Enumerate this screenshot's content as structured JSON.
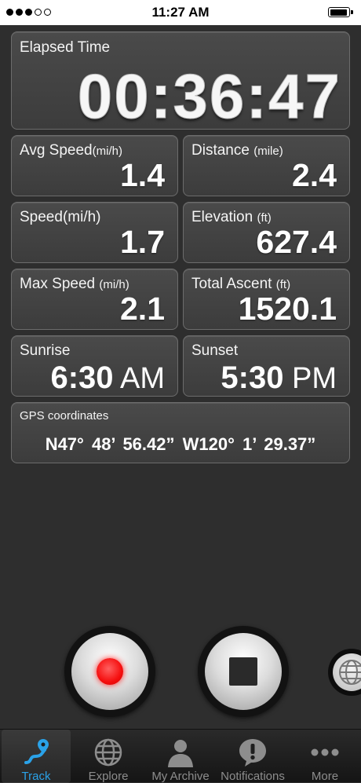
{
  "status_bar": {
    "time": "11:27 AM",
    "signal_bars_filled": 3,
    "signal_bars_total": 5
  },
  "elapsed": {
    "label": "Elapsed Time",
    "value": "00:36:47"
  },
  "stats": {
    "avg_speed": {
      "label": "Avg Speed",
      "unit": "(mi/h)",
      "value": "1.4"
    },
    "distance": {
      "label": "Distance",
      "unit": "(mile)",
      "value": "2.4"
    },
    "speed": {
      "label": "Speed(mi/h)",
      "value": "1.7"
    },
    "elevation": {
      "label": "Elevation",
      "unit": "(ft)",
      "value": "627.4"
    },
    "max_speed": {
      "label": "Max Speed",
      "unit": "(mi/h)",
      "value": "2.1"
    },
    "total_ascent": {
      "label": "Total Ascent",
      "unit": "(ft)",
      "value": "1520.1"
    },
    "sunrise": {
      "label": "Sunrise",
      "value": "6:30",
      "ampm": "AM"
    },
    "sunset": {
      "label": "Sunset",
      "value": "5:30",
      "ampm": "PM"
    }
  },
  "gps": {
    "label": "GPS coordinates",
    "value": "N47° 48’ 56.42”  W120° 1’ 29.37”"
  },
  "controls": {
    "record_icon": "record-icon",
    "stop_icon": "stop-icon",
    "globe_icon": "globe-icon"
  },
  "tabs": [
    {
      "label": "Track",
      "icon": "track-route-icon",
      "active": true
    },
    {
      "label": "Explore",
      "icon": "globe-icon",
      "active": false
    },
    {
      "label": "My Archive",
      "icon": "person-icon",
      "active": false
    },
    {
      "label": "Notifications",
      "icon": "exclamation-bubble-icon",
      "active": false
    },
    {
      "label": "More",
      "icon": "ellipsis-icon",
      "active": false
    }
  ],
  "colors": {
    "background": "#2e2e2e",
    "panel": "#444444",
    "accent": "#2aa2e8",
    "record": "#f50e0e"
  }
}
